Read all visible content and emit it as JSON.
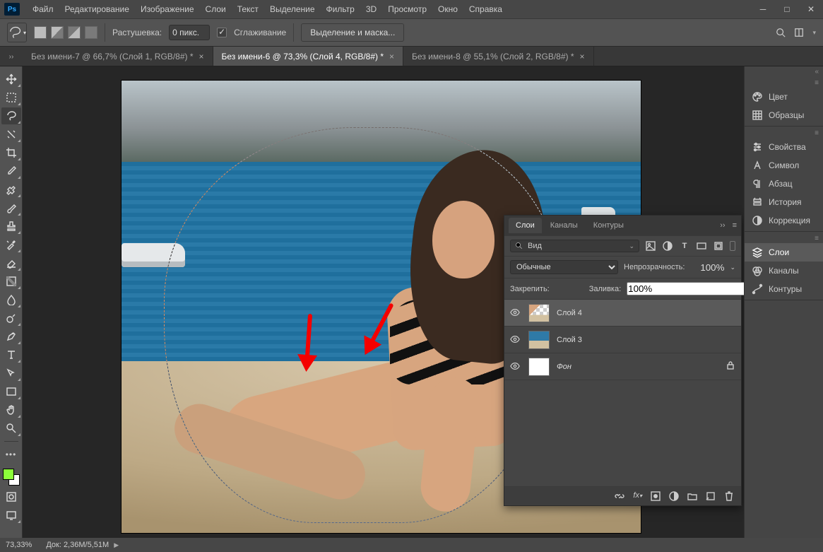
{
  "app": {
    "logo": "Ps"
  },
  "menu": [
    "Файл",
    "Редактирование",
    "Изображение",
    "Слои",
    "Текст",
    "Выделение",
    "Фильтр",
    "3D",
    "Просмотр",
    "Окно",
    "Справка"
  ],
  "optionsbar": {
    "feather_label": "Растушевка:",
    "feather_value": "0 пикс.",
    "antialias_label": "Сглаживание",
    "antialias_checked": true,
    "select_mask_btn": "Выделение и маска..."
  },
  "tabs": [
    {
      "title": "Без имени-7 @ 66,7% (Слой 1, RGB/8#) *",
      "active": false
    },
    {
      "title": "Без имени-6 @ 73,3% (Слой 4, RGB/8#) *",
      "active": true
    },
    {
      "title": "Без имени-8 @ 55,1% (Слой 2, RGB/8#) *",
      "active": false
    }
  ],
  "layers_panel": {
    "tabs": [
      "Слои",
      "Каналы",
      "Контуры"
    ],
    "active_tab": 0,
    "filter_kind": "Вид",
    "blend_mode": "Обычные",
    "opacity_label": "Непрозрачность:",
    "opacity_value": "100%",
    "lock_label": "Закрепить:",
    "fill_label": "Заливка:",
    "fill_value": "100%",
    "layers": [
      {
        "name": "Слой 4",
        "thumb": "checker",
        "visible": true,
        "selected": true,
        "italic": false,
        "locked": false
      },
      {
        "name": "Слой 3",
        "thumb": "photo",
        "visible": true,
        "selected": false,
        "italic": false,
        "locked": false
      },
      {
        "name": "Фон",
        "thumb": "white",
        "visible": true,
        "selected": false,
        "italic": true,
        "locked": true
      }
    ]
  },
  "right_dock": [
    {
      "group": [
        {
          "icon": "palette",
          "label": "Цвет"
        },
        {
          "icon": "grid",
          "label": "Образцы"
        }
      ]
    },
    {
      "group": [
        {
          "icon": "sliders",
          "label": "Свойства"
        },
        {
          "icon": "A",
          "label": "Символ"
        },
        {
          "icon": "para",
          "label": "Абзац"
        },
        {
          "icon": "history",
          "label": "История"
        },
        {
          "icon": "adjust",
          "label": "Коррекция"
        }
      ]
    },
    {
      "group": [
        {
          "icon": "layers",
          "label": "Слои",
          "selected": true
        },
        {
          "icon": "channels",
          "label": "Каналы"
        },
        {
          "icon": "paths",
          "label": "Контуры"
        }
      ]
    }
  ],
  "statusbar": {
    "zoom": "73,33%",
    "doc_label": "Док:",
    "doc_value": "2,36M/5,51M"
  },
  "tools": [
    "move",
    "rect-marquee",
    "lasso",
    "magic-lasso",
    "crop",
    "eyedrop",
    "heal",
    "brush",
    "stamp",
    "history-brush",
    "eraser",
    "gradient",
    "blur",
    "dodge",
    "pen",
    "type",
    "path-sel",
    "rect",
    "hand",
    "zoom"
  ],
  "selected_tool": 2,
  "extra_tools": [
    "edit-toolbar",
    "quickmask",
    "screenmode"
  ]
}
